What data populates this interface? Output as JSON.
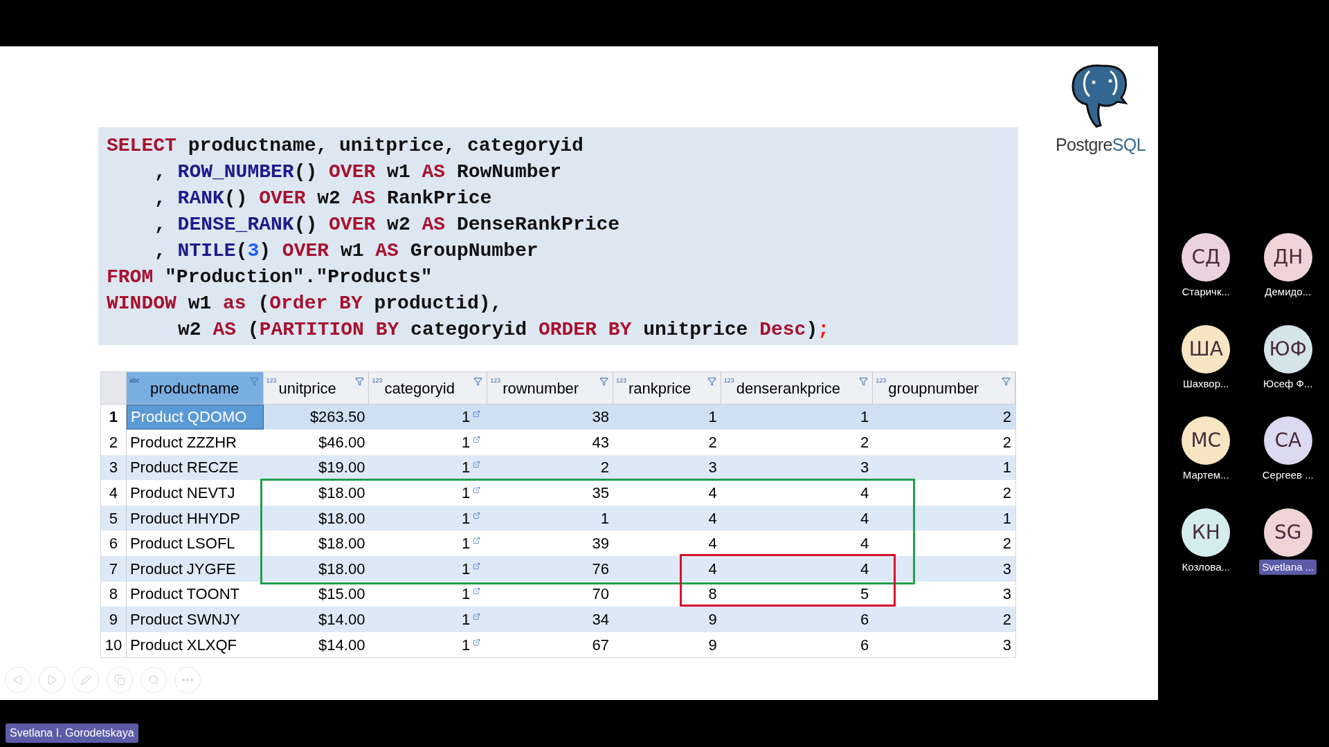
{
  "slide": {
    "logo": {
      "prefix": "Postgre",
      "suffix": "SQL"
    },
    "code": [
      {
        "kind": "top",
        "tokens": [
          {
            "t": "SELECT",
            "kind": "kw"
          },
          {
            "t": " productname, unitprice, categoryid",
            "kind": "plain"
          }
        ]
      },
      {
        "kind": "item",
        "tokens": [
          {
            "t": ", ",
            "kind": "plain"
          },
          {
            "t": "ROW_NUMBER",
            "kind": "fn"
          },
          {
            "t": "() ",
            "kind": "plain"
          },
          {
            "t": "OVER",
            "kind": "kw"
          },
          {
            "t": " w1 ",
            "kind": "plain"
          },
          {
            "t": "AS",
            "kind": "kw"
          },
          {
            "t": " RowNumber",
            "kind": "plain"
          }
        ]
      },
      {
        "kind": "item",
        "tokens": [
          {
            "t": ", ",
            "kind": "plain"
          },
          {
            "t": "RANK",
            "kind": "fn"
          },
          {
            "t": "() ",
            "kind": "plain"
          },
          {
            "t": "OVER",
            "kind": "kw"
          },
          {
            "t": " w2 ",
            "kind": "plain"
          },
          {
            "t": "AS",
            "kind": "kw"
          },
          {
            "t": " RankPrice",
            "kind": "plain"
          }
        ]
      },
      {
        "kind": "item",
        "tokens": [
          {
            "t": ", ",
            "kind": "plain"
          },
          {
            "t": "DENSE_RANK",
            "kind": "fn"
          },
          {
            "t": "() ",
            "kind": "plain"
          },
          {
            "t": "OVER",
            "kind": "kw"
          },
          {
            "t": " w2 ",
            "kind": "plain"
          },
          {
            "t": "AS",
            "kind": "kw"
          },
          {
            "t": " DenseRankPrice",
            "kind": "plain"
          }
        ]
      },
      {
        "kind": "item",
        "tokens": [
          {
            "t": ", ",
            "kind": "plain"
          },
          {
            "t": "NTILE",
            "kind": "fn"
          },
          {
            "t": "(",
            "kind": "plain"
          },
          {
            "t": "3",
            "kind": "num"
          },
          {
            "t": ") ",
            "kind": "plain"
          },
          {
            "t": "OVER",
            "kind": "kw"
          },
          {
            "t": " w1 ",
            "kind": "plain"
          },
          {
            "t": "AS",
            "kind": "kw"
          },
          {
            "t": " GroupNumber",
            "kind": "plain"
          }
        ]
      },
      {
        "kind": "top",
        "tokens": [
          {
            "t": "FROM",
            "kind": "kw"
          },
          {
            "t": " \"Production\".\"Products\"",
            "kind": "plain"
          }
        ]
      },
      {
        "kind": "top",
        "tokens": [
          {
            "t": "WINDOW",
            "kind": "kw"
          },
          {
            "t": " w1 ",
            "kind": "plain"
          },
          {
            "t": "as",
            "kind": "kw"
          },
          {
            "t": " (",
            "kind": "plain"
          },
          {
            "t": "Order BY",
            "kind": "kw"
          },
          {
            "t": " productid),",
            "kind": "plain"
          }
        ]
      },
      {
        "kind": "window_item",
        "tokens": [
          {
            "t": "w2 ",
            "kind": "plain"
          },
          {
            "t": "AS",
            "kind": "kw"
          },
          {
            "t": " (",
            "kind": "plain"
          },
          {
            "t": "PARTITION BY",
            "kind": "kw"
          },
          {
            "t": " categoryid ",
            "kind": "plain"
          },
          {
            "t": "ORDER BY",
            "kind": "kw"
          },
          {
            "t": " unitprice ",
            "kind": "plain"
          },
          {
            "t": "Desc",
            "kind": "kw"
          },
          {
            "t": ")",
            "kind": "plain"
          },
          {
            "t": ";",
            "kind": "punct"
          }
        ]
      }
    ],
    "table": {
      "columns": [
        {
          "label": "productname",
          "type": "abc",
          "selected": true
        },
        {
          "label": "unitprice",
          "type": "123",
          "selected": false
        },
        {
          "label": "categoryid",
          "type": "123",
          "selected": false
        },
        {
          "label": "rownumber",
          "type": "123",
          "selected": false
        },
        {
          "label": "rankprice",
          "type": "123",
          "selected": false
        },
        {
          "label": "denserankprice",
          "type": "123",
          "selected": false
        },
        {
          "label": "groupnumber",
          "type": "123",
          "selected": false
        }
      ],
      "rows": [
        {
          "num": "1",
          "selected": true,
          "cells": [
            "Product QDOMO",
            "$263.50",
            "1",
            "38",
            "1",
            "1",
            "2"
          ]
        },
        {
          "num": "2",
          "selected": false,
          "cells": [
            "Product ZZZHR",
            "$46.00",
            "1",
            "43",
            "2",
            "2",
            "2"
          ]
        },
        {
          "num": "3",
          "selected": false,
          "cells": [
            "Product RECZE",
            "$19.00",
            "1",
            "2",
            "3",
            "3",
            "1"
          ]
        },
        {
          "num": "4",
          "selected": false,
          "cells": [
            "Product NEVTJ",
            "$18.00",
            "1",
            "35",
            "4",
            "4",
            "2"
          ]
        },
        {
          "num": "5",
          "selected": false,
          "cells": [
            "Product HHYDP",
            "$18.00",
            "1",
            "1",
            "4",
            "4",
            "1"
          ]
        },
        {
          "num": "6",
          "selected": false,
          "cells": [
            "Product LSOFL",
            "$18.00",
            "1",
            "39",
            "4",
            "4",
            "2"
          ]
        },
        {
          "num": "7",
          "selected": false,
          "cells": [
            "Product JYGFE",
            "$18.00",
            "1",
            "76",
            "4",
            "4",
            "3"
          ]
        },
        {
          "num": "8",
          "selected": false,
          "cells": [
            "Product TOONT",
            "$15.00",
            "1",
            "70",
            "8",
            "5",
            "3"
          ]
        },
        {
          "num": "9",
          "selected": false,
          "cells": [
            "Product SWNJY",
            "$14.00",
            "1",
            "34",
            "9",
            "6",
            "2"
          ]
        },
        {
          "num": "10",
          "selected": false,
          "cells": [
            "Product XLXQF",
            "$14.00",
            "1",
            "67",
            "9",
            "6",
            "3"
          ]
        }
      ],
      "annotation_boxes": [
        {
          "color": "#1ea04e"
        },
        {
          "color": "#d8102c"
        }
      ]
    }
  },
  "participants": [
    {
      "initials": "СД",
      "name": "Старичк...",
      "color": "#ead3df",
      "active": false
    },
    {
      "initials": "ДН",
      "name": "Демидо...",
      "color": "#efd3d7",
      "active": false
    },
    {
      "initials": "ША",
      "name": "Шахвор...",
      "color": "#f7e5c3",
      "active": false
    },
    {
      "initials": "ЮФ",
      "name": "Юсеф Ф...",
      "color": "#d4e4ea",
      "active": false
    },
    {
      "initials": "МС",
      "name": "Мартем...",
      "color": "#f7e5c3",
      "active": false
    },
    {
      "initials": "СА",
      "name": "Сергеев ...",
      "color": "#dcdaf0",
      "active": false
    },
    {
      "initials": "КН",
      "name": "Козлова...",
      "color": "#d4ecec",
      "active": false
    },
    {
      "initials": "SG",
      "name": "Svetlana ...",
      "color": "#efd3d7",
      "active": true
    }
  ],
  "presenter": "Svetlana I. Gorodetskaya"
}
